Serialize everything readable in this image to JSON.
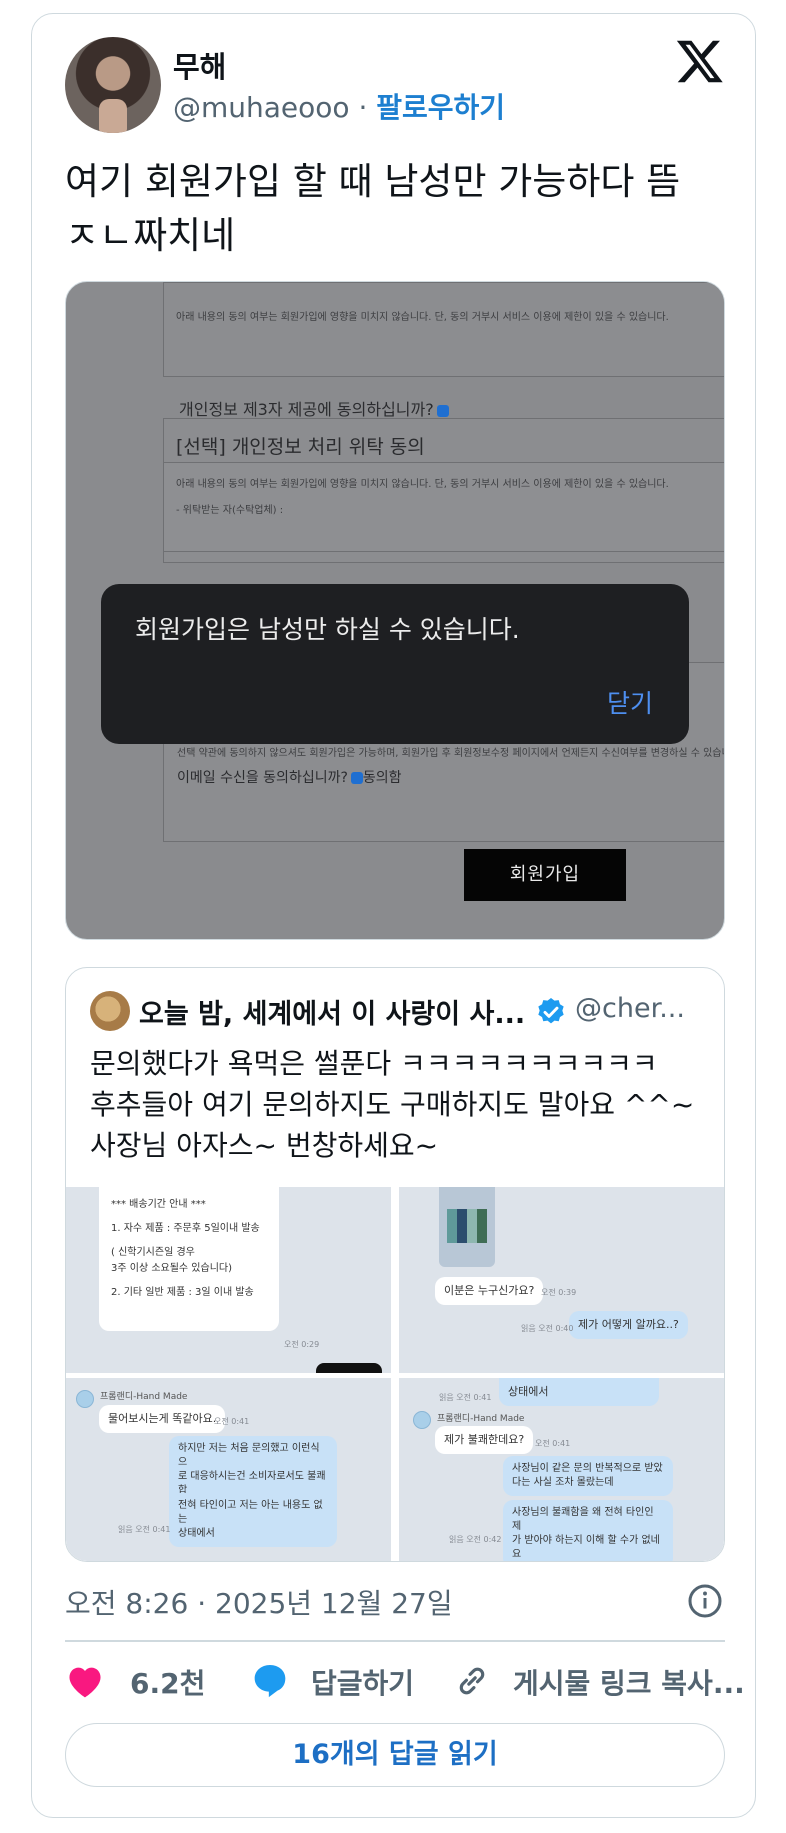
{
  "author": {
    "display_name": "무해",
    "handle": "@muhaeooo",
    "separator": "·",
    "follow_label": "팔로우하기"
  },
  "tweet": {
    "text": "여기 회원가입 할 때 남성만 가능하다 뜸 ㅈㄴ짜치네"
  },
  "screenshot_form": {
    "notice_1": "아래 내용의 동의 여부는 회원가입에 영향을 미치지 않습니다. 단, 동의 거부시 서비스 이용에 제한이 있을 수 있습니다.",
    "notice_2": "아래 내용의 동의 여부는 회원가입에 영향을 미치지 않습니다. 단, 동의 거부시 서비스 이용에 제한이 있을 수 있습니다.",
    "consignee": "- 위탁받는 자(수탁업체) :",
    "third_party_question": "개인정보 제3자 제공에 동의하십니까?",
    "section_title": "[선택] 개인정보 처리 위탁 동의",
    "email_notice": "선택 약관에 동의하지 않으셔도 회원가입은 가능하며, 회원가입 후 회원정보수정 페이지에서 언제든지 수신여부를 변경하실 수 있습니다.",
    "email_question": "이메일 수신을 동의하십니까?",
    "email_agree": "동의함",
    "join_button": "회원가입",
    "dialog_message": "회원가입은 남성만 하실 수 있습니다.",
    "dialog_close": "닫기"
  },
  "quote": {
    "name": "오늘 밤, 세계에서 이 사랑이 사...",
    "handle": "@cher...",
    "text_line1": "문의했다가 욕먹은 썰푼다 ㅋㅋㅋㅋㅋㅋㅋㅋㅋㅋ",
    "text_line2": "후추들아 여기 문의하지도 구매하지도 말아요 ^^~",
    "text_line3": "사장님 아자스~ 번창하세요~",
    "chat": {
      "shipping_title": "*** 배송기간 안내 ***",
      "shipping_1": "1. 자수 제품 : 주문후 5일이내 발송",
      "shipping_note": "( 신학기시즌일 경우\n3주 이상 소요될수 있습니다)",
      "shipping_2": "2. 기타 일반 제품 : 3일 이내 발송",
      "time_029": "오전 0:29",
      "who_are_you": "이분은 누구신가요?",
      "time_039": "오전 0:39",
      "how_know": "제가 어떻게 알까요..?",
      "read_040": "읽음 오전 0:40",
      "state_top": "상태에서",
      "read_041": "읽음 오전 0:41",
      "shop": "프롬랜디-Hand Made",
      "same_question": "물어보시는게 똑같아요.",
      "time_041": "오전 0:41",
      "first_inquiry": "하지만 저는 처음 문의했고 이런식으\n로 대응하시는건 소비자로서도 불쾌합\n니다",
      "stranger": "전혀 타인이고 저는 아는 내용도 없는\n상태에서",
      "read_041b": "읽음 오전 0:41",
      "unpleasant": "제가 불쾌한데요?",
      "time_041b": "오전 0:41",
      "same_repeated": "사장님이 같은 문의 반복적으로 받았\n다는 사실 조차 몰랐는데",
      "why_me": "사장님의 불쾌함을 왜 전혀 타인인 제\n가 받아야 하는지 이해 할 수가 없네요",
      "read_042": "읽음 오전 0:42"
    }
  },
  "meta": {
    "timestamp": "오전 8:26 · 2025년 12월 27일"
  },
  "actions": {
    "likes": "6.2천",
    "reply": "답글하기",
    "copy_link": "게시물 링크 복사..."
  },
  "read_replies": "16개의 답글 읽기",
  "colors": {
    "link_blue": "#1d7fd0",
    "heart": "#f91880",
    "reply_blue": "#1d9bf0",
    "verified": "#1d9bf0"
  }
}
